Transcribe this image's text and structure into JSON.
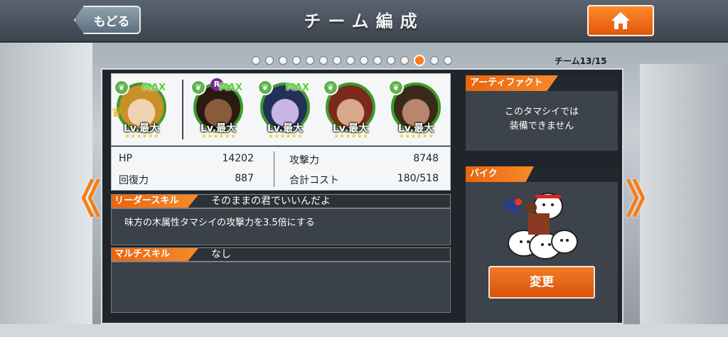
{
  "header": {
    "back_label": "もどる",
    "title": "チーム編成",
    "home_icon": "home-icon"
  },
  "pager": {
    "total_dots": 15,
    "active_index": 13,
    "label": "チーム13/15"
  },
  "team": [
    {
      "level": "Lv.最大",
      "max": "MAX",
      "leader": true,
      "rank": "",
      "stars": "★★★★★★"
    },
    {
      "level": "Lv.最大",
      "max": "MAX",
      "leader": false,
      "rank": "R",
      "stars": "★★★★★★"
    },
    {
      "level": "Lv.最大",
      "max": "MAX",
      "leader": false,
      "rank": "",
      "stars": "★★★★★★"
    },
    {
      "level": "Lv.最大",
      "max": "",
      "leader": false,
      "rank": "",
      "stars": "★★★★★★"
    },
    {
      "level": "Lv.最大",
      "max": "",
      "leader": false,
      "rank": "",
      "stars": "★★★★★★"
    }
  ],
  "stats": {
    "hp_label": "HP",
    "hp_value": "14202",
    "attack_label": "攻撃力",
    "attack_value": "8748",
    "recovery_label": "回復力",
    "recovery_value": "887",
    "cost_label": "合計コスト",
    "cost_value": "180/518"
  },
  "leader_skill": {
    "tag": "リーダースキル",
    "name": "そのままの君でいいんだよ",
    "description": "味方の木属性タマシイの攻撃力を3.5倍にする"
  },
  "multi_skill": {
    "tag": "マルチスキル",
    "name": "なし"
  },
  "artifact": {
    "tag": "アーティファクト",
    "text_line1": "このタマシイでは",
    "text_line2": "装備できません"
  },
  "bike": {
    "tag": "バイク",
    "change_label": "変更"
  },
  "colors": {
    "accent_orange": "#f07a1e",
    "nature_green": "#3d9a2b",
    "panel_dark": "#1f252b"
  }
}
